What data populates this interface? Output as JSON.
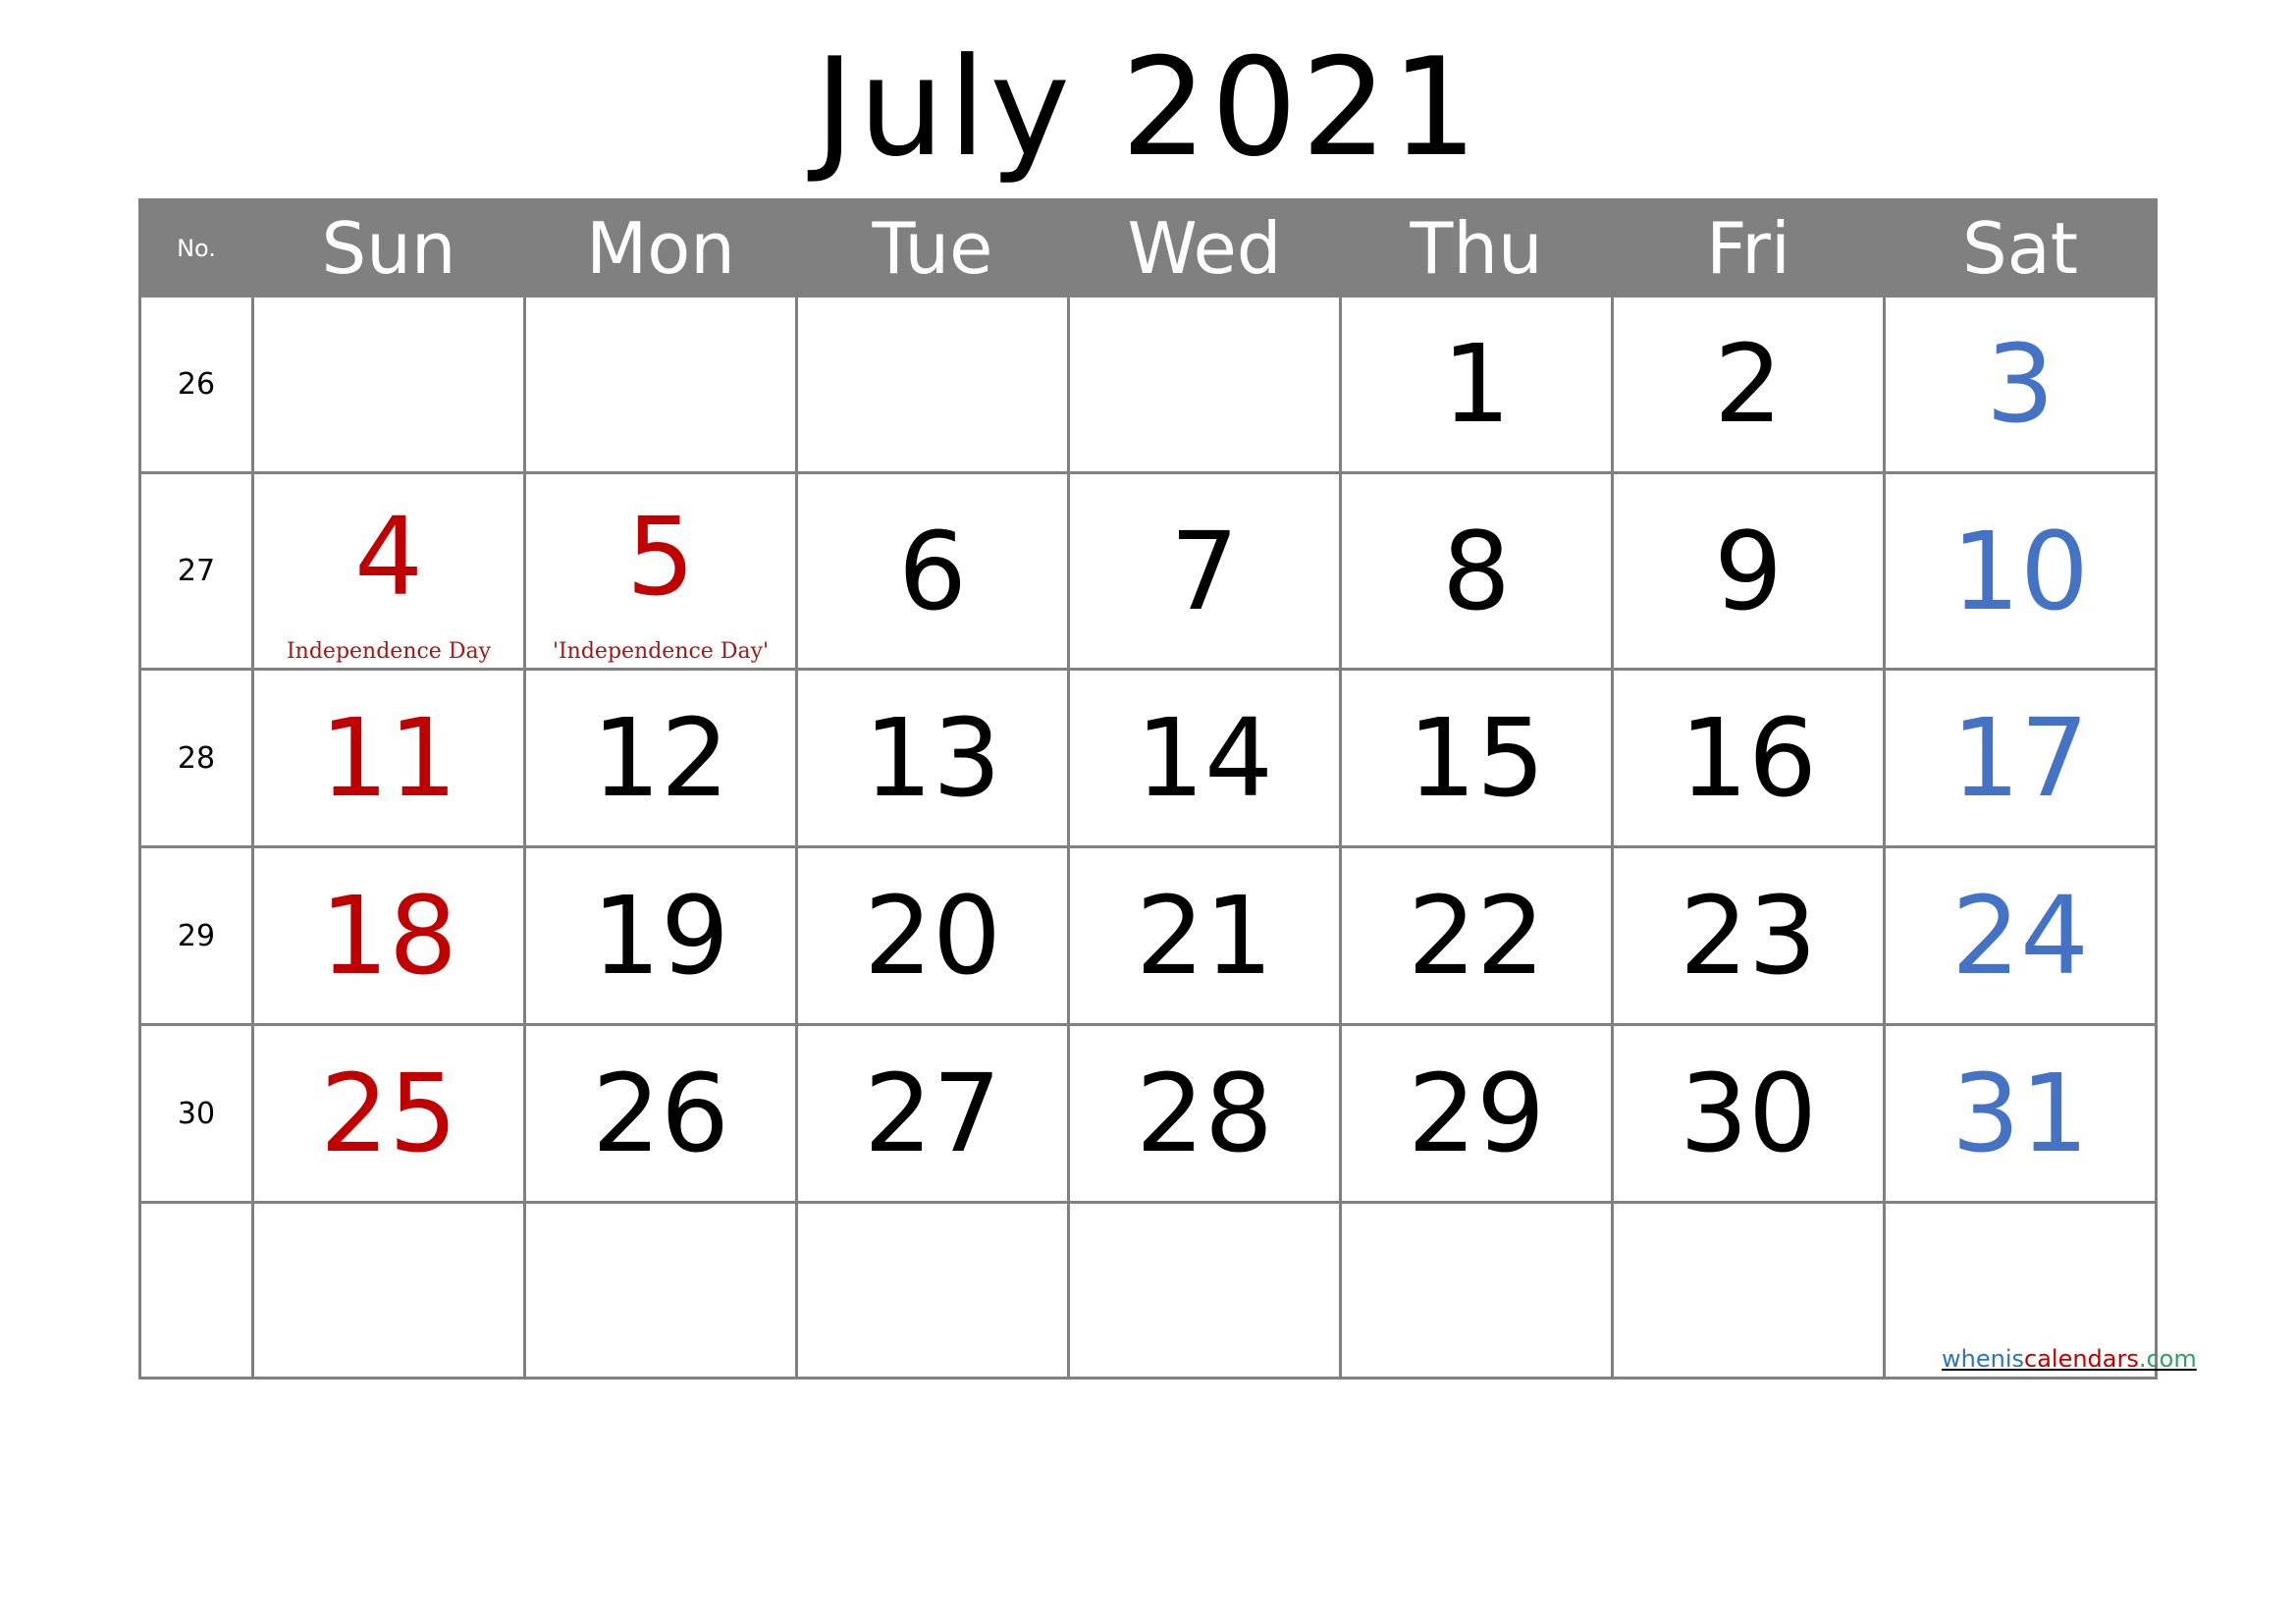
{
  "title": "July 2021",
  "header": {
    "week_no_label": "No.",
    "days": [
      "Sun",
      "Mon",
      "Tue",
      "Wed",
      "Thu",
      "Fri",
      "Sat"
    ]
  },
  "colors": {
    "weekend_sunday": "#C00000",
    "weekend_saturday": "#4472C4",
    "holiday": "#C00000",
    "header_bg": "#808080"
  },
  "weeks": [
    {
      "no": "26",
      "days": [
        "",
        "",
        "",
        "",
        "1",
        "2",
        "3"
      ]
    },
    {
      "no": "27",
      "days": [
        "4",
        "5",
        "6",
        "7",
        "8",
        "9",
        "10"
      ]
    },
    {
      "no": "28",
      "days": [
        "11",
        "12",
        "13",
        "14",
        "15",
        "16",
        "17"
      ]
    },
    {
      "no": "29",
      "days": [
        "18",
        "19",
        "20",
        "21",
        "22",
        "23",
        "24"
      ]
    },
    {
      "no": "30",
      "days": [
        "25",
        "26",
        "27",
        "28",
        "29",
        "30",
        "31"
      ]
    },
    {
      "no": "",
      "days": [
        "",
        "",
        "",
        "",
        "",
        "",
        ""
      ]
    }
  ],
  "holidays": {
    "4": "Independence Day",
    "5": "'Independence Day'"
  },
  "watermark": {
    "part1": "whenis",
    "part2": "calendars",
    "part3": ".com"
  }
}
